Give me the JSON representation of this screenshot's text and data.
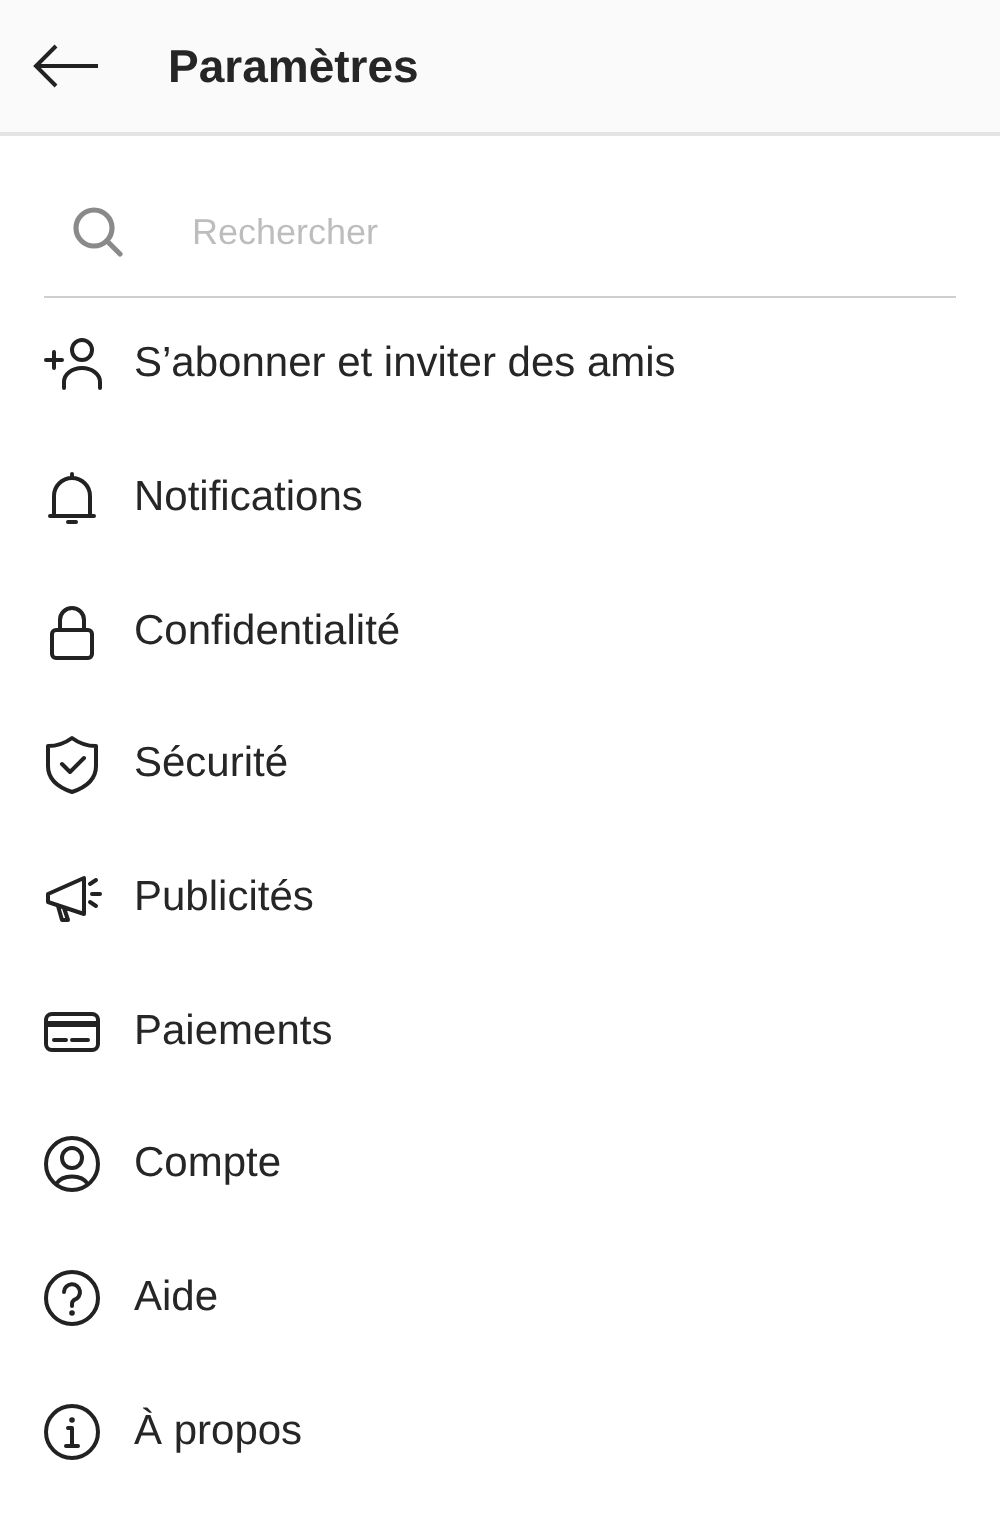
{
  "header": {
    "title": "Paramètres"
  },
  "search": {
    "placeholder": "Rechercher"
  },
  "items": [
    {
      "kind": "add-person",
      "label": "S’abonner et inviter des amis"
    },
    {
      "kind": "bell",
      "label": "Notifications"
    },
    {
      "kind": "lock",
      "label": "Confidentialité"
    },
    {
      "kind": "shield",
      "label": "Sécurité"
    },
    {
      "kind": "megaphone",
      "label": "Publicités"
    },
    {
      "kind": "card",
      "label": "Paiements"
    },
    {
      "kind": "account",
      "label": "Compte"
    },
    {
      "kind": "help",
      "label": "Aide"
    },
    {
      "kind": "info",
      "label": "À propos"
    }
  ]
}
